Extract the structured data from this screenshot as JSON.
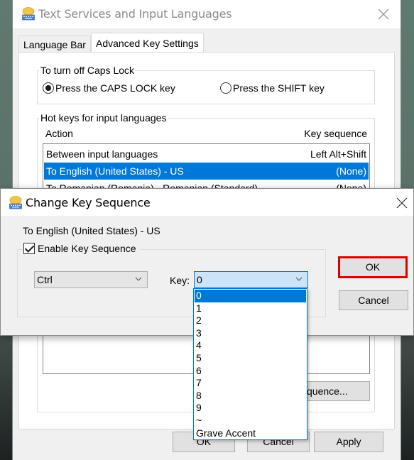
{
  "main_window": {
    "title": "Text Services and Input Languages",
    "tabs": [
      {
        "label": "Language Bar",
        "active": false
      },
      {
        "label": "Advanced Key Settings",
        "active": true
      }
    ],
    "caps_lock_group": {
      "legend": "To turn off Caps Lock",
      "options": [
        {
          "label": "Press the CAPS LOCK key",
          "checked": true
        },
        {
          "label": "Press the SHIFT key",
          "checked": false
        }
      ]
    },
    "hotkeys_group": {
      "legend": "Hot keys for input languages",
      "columns": {
        "action": "Action",
        "key_sequence": "Key sequence"
      },
      "rows": [
        {
          "action": "Between input languages",
          "key_sequence": "Left Alt+Shift",
          "selected": false
        },
        {
          "action": "To English (United States) - US",
          "key_sequence": "(None)",
          "selected": true
        },
        {
          "action": "To Romanian (Romania) - Romanian (Standard)",
          "key_sequence": "(None)",
          "selected": false
        }
      ],
      "change_button_partial": "quence..."
    },
    "buttons": {
      "ok": "OK",
      "cancel": "Cancel",
      "apply": "Apply"
    }
  },
  "dialog": {
    "title": "Change Key Sequence",
    "target_label": "To English (United States) - US",
    "enable_checkbox": {
      "label": "Enable Key Sequence",
      "checked": true
    },
    "modifier_combo": {
      "value": "Ctrl"
    },
    "key_label": "Key:",
    "key_combo": {
      "value": "0"
    },
    "key_options": [
      "0",
      "1",
      "2",
      "3",
      "4",
      "5",
      "6",
      "7",
      "8",
      "9",
      "~",
      "Grave Accent"
    ],
    "key_selected_index": 0,
    "buttons": {
      "ok": "OK",
      "cancel": "Cancel"
    },
    "highlight_color": "#e00000"
  },
  "colors": {
    "selection": "#0078d7",
    "combo_focus": "#cce4f7"
  }
}
